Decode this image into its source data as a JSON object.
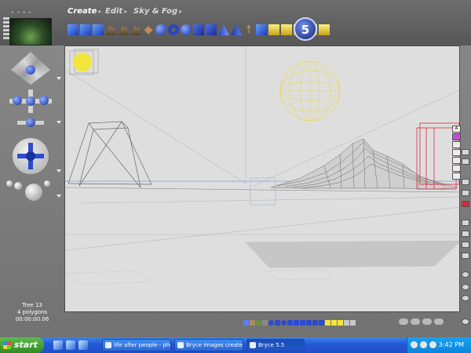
{
  "menu": {
    "items": [
      {
        "label": "Create",
        "active": true
      },
      {
        "label": "Edit",
        "active": false
      },
      {
        "label": "Sky & Fog",
        "active": false
      }
    ]
  },
  "selection": {
    "name": "Tree 13",
    "polygons": "4 polygons",
    "time": "00:00:00.06"
  },
  "taskbar": {
    "start_label": "start",
    "tasks": [
      {
        "label": "life after people - pho...",
        "active": false
      },
      {
        "label": "Bryce images created...",
        "active": false
      },
      {
        "label": "Bryce 5.5",
        "active": true
      }
    ],
    "clock": "3:42 PM"
  },
  "logo": {
    "letter": "5"
  },
  "colors": {
    "accent_blue": "#2c4bd0",
    "sun_yellow": "#f2e63a",
    "wire_gray": "#555555",
    "selected_red": "#d8283e",
    "taskbar_blue": "#2457d4",
    "start_green": "#3a9a2a"
  },
  "icons": {
    "palette": [
      "infinite-plane-icon",
      "water-plane-icon",
      "cloud-plane-icon",
      "terrain-icon",
      "stone-icon",
      "tree-icon",
      "sphere-icon",
      "torus-icon",
      "cylinder-icon",
      "cube-icon",
      "cone-icon",
      "pyramid-icon",
      "disc-icon",
      "figure-icon",
      "light-icon"
    ]
  }
}
